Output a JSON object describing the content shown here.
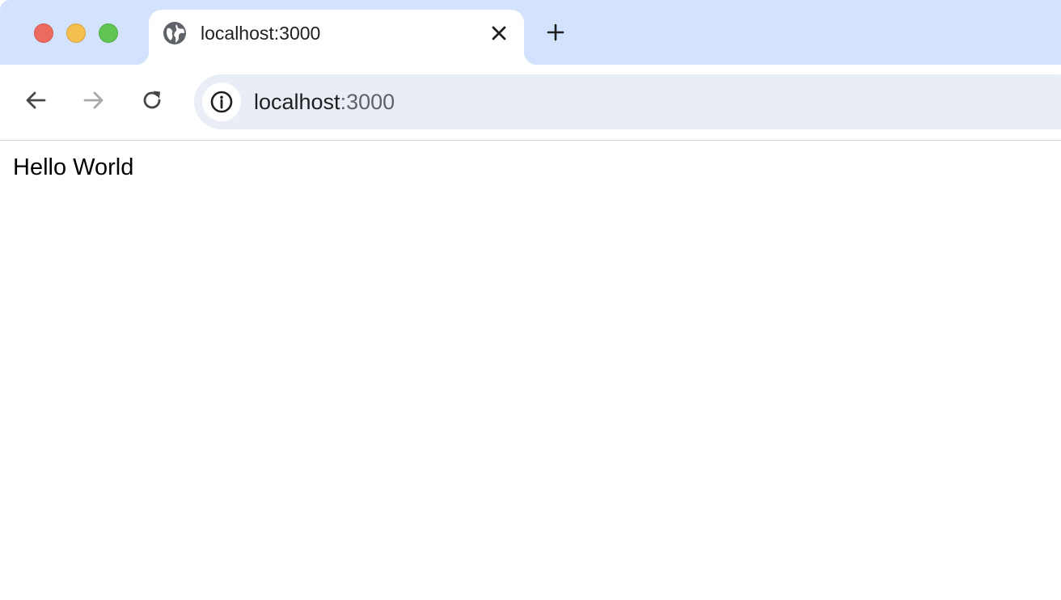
{
  "window": {
    "traffic_lights": [
      "close",
      "minimize",
      "maximize"
    ],
    "colors": {
      "close": "#ed6a5e",
      "minimize": "#f5bf4f",
      "maximize": "#61c554",
      "tabstrip": "#d3e3fd",
      "omnibox": "#e9eef6"
    }
  },
  "tab": {
    "title": "localhost:3000",
    "favicon": "globe-icon",
    "close_icon": "close-icon"
  },
  "newtab_icon": "plus-icon",
  "nav": {
    "back_icon": "arrow-left-icon",
    "forward_icon": "arrow-right-icon",
    "reload_icon": "reload-icon"
  },
  "omnibox": {
    "site_info_icon": "info-icon",
    "host": "localhost",
    "port": ":3000"
  },
  "page": {
    "text": "Hello World"
  }
}
